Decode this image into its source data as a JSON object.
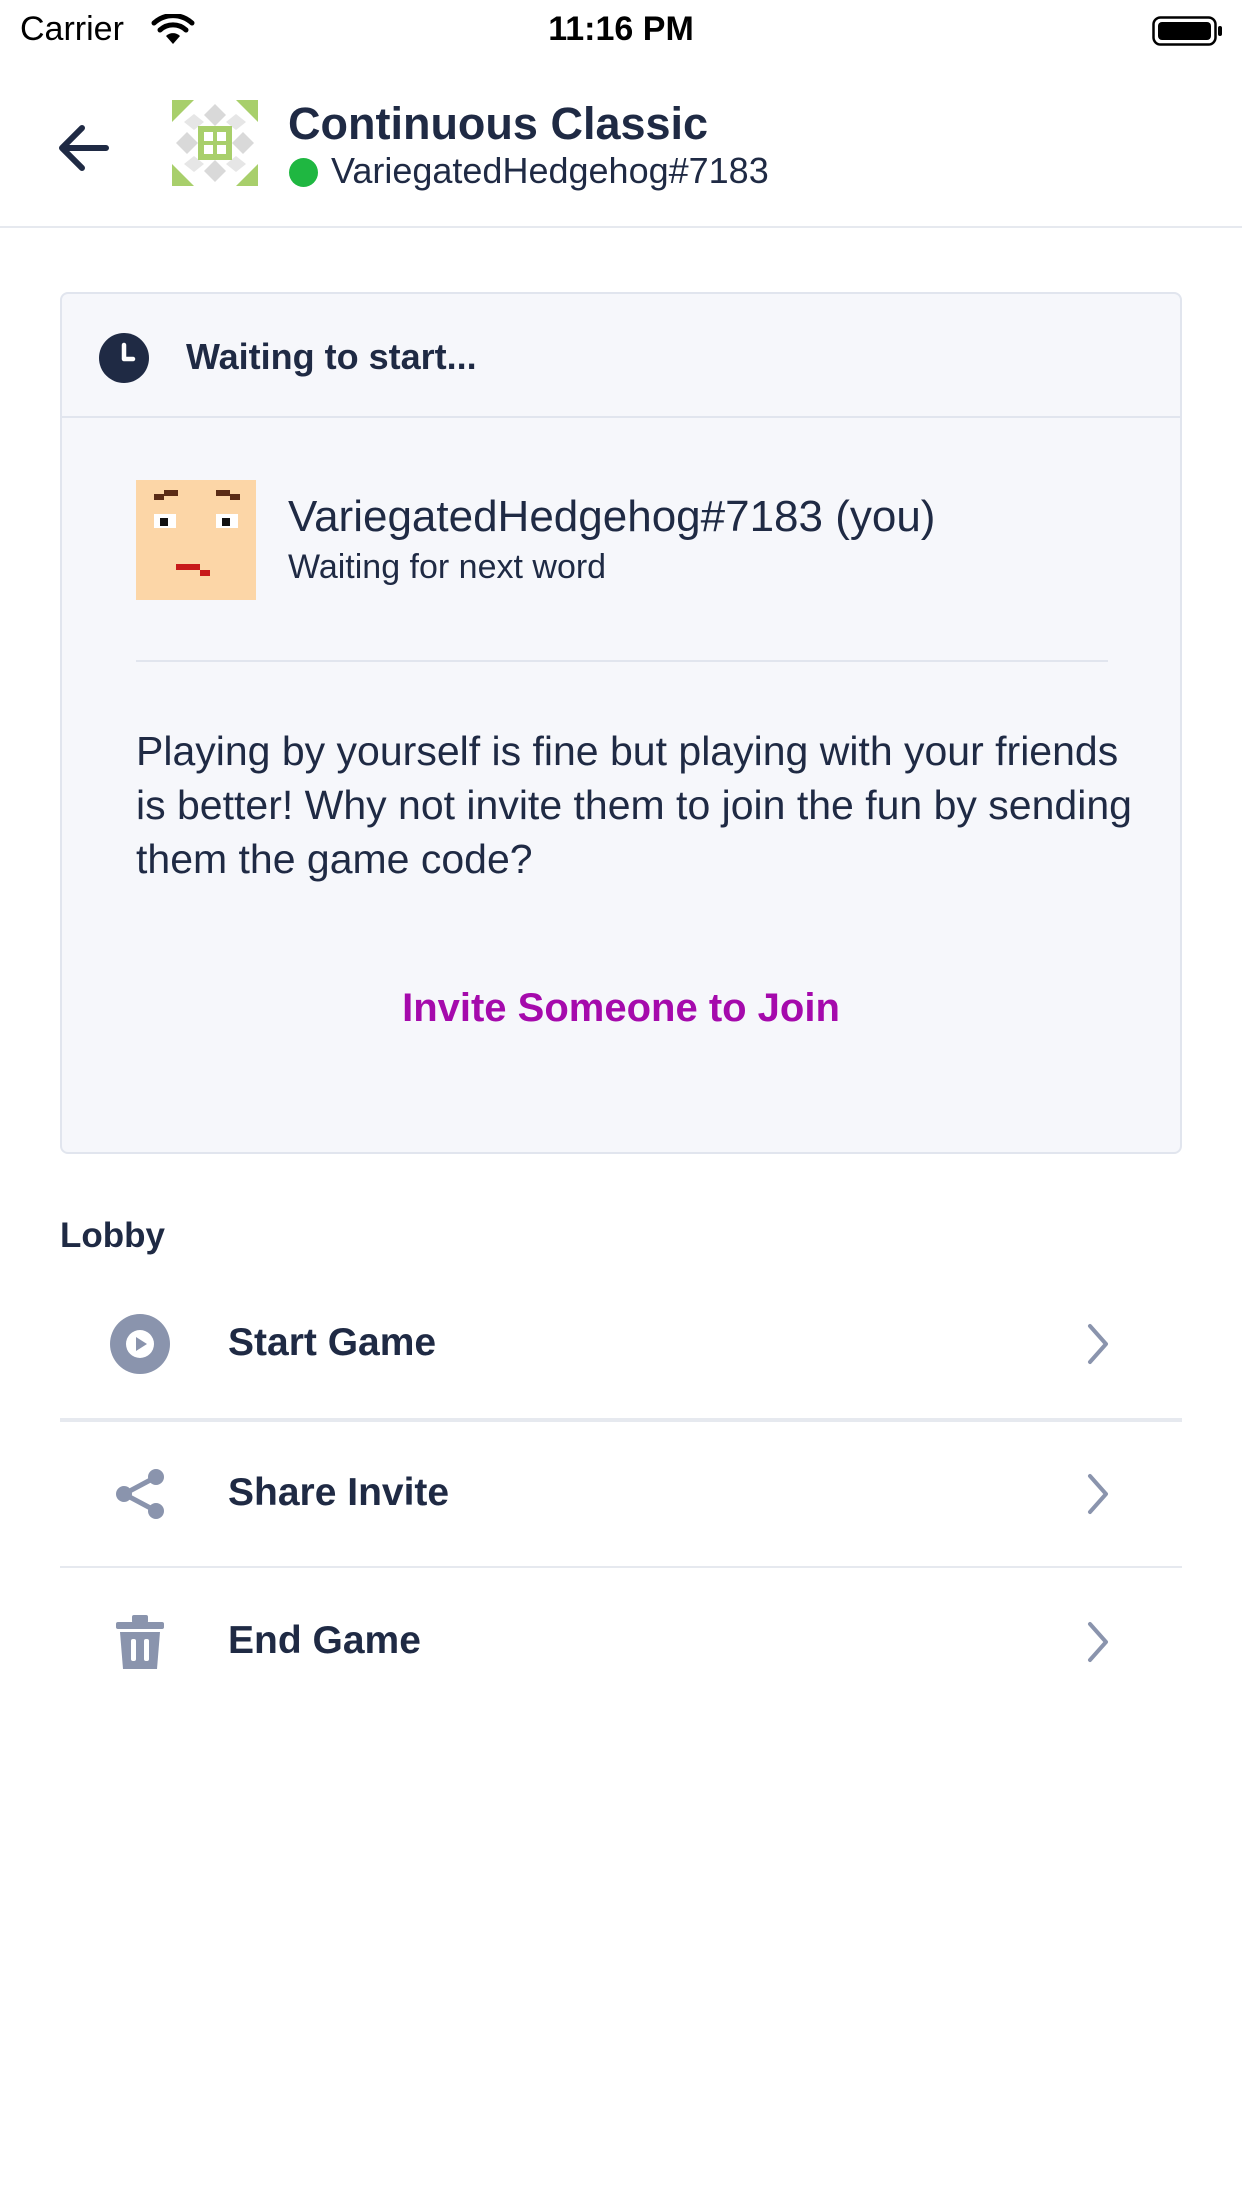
{
  "status_bar": {
    "carrier": "Carrier",
    "time": "11:16 PM"
  },
  "header": {
    "title": "Continuous Classic",
    "user": "VariegatedHedgehog#7183",
    "online_color": "#1fb741"
  },
  "card": {
    "title": "Waiting to start...",
    "player": {
      "name": "VariegatedHedgehog#7183 (you)",
      "status": "Waiting for next word"
    },
    "invite_message": "Playing by yourself is fine but playing with your friends is better! Why not invite them to join the fun by sending them the game code?",
    "invite_link": "Invite Someone to Join"
  },
  "lobby": {
    "heading": "Lobby",
    "items": [
      {
        "label": "Start Game",
        "icon": "play-circle-icon"
      },
      {
        "label": "Share Invite",
        "icon": "share-icon"
      },
      {
        "label": "End Game",
        "icon": "trash-icon"
      }
    ]
  },
  "colors": {
    "text": "#1f2a44",
    "accent": "#a50aac",
    "icon_gray": "#8a94ad",
    "card_bg": "#f6f7fb"
  }
}
